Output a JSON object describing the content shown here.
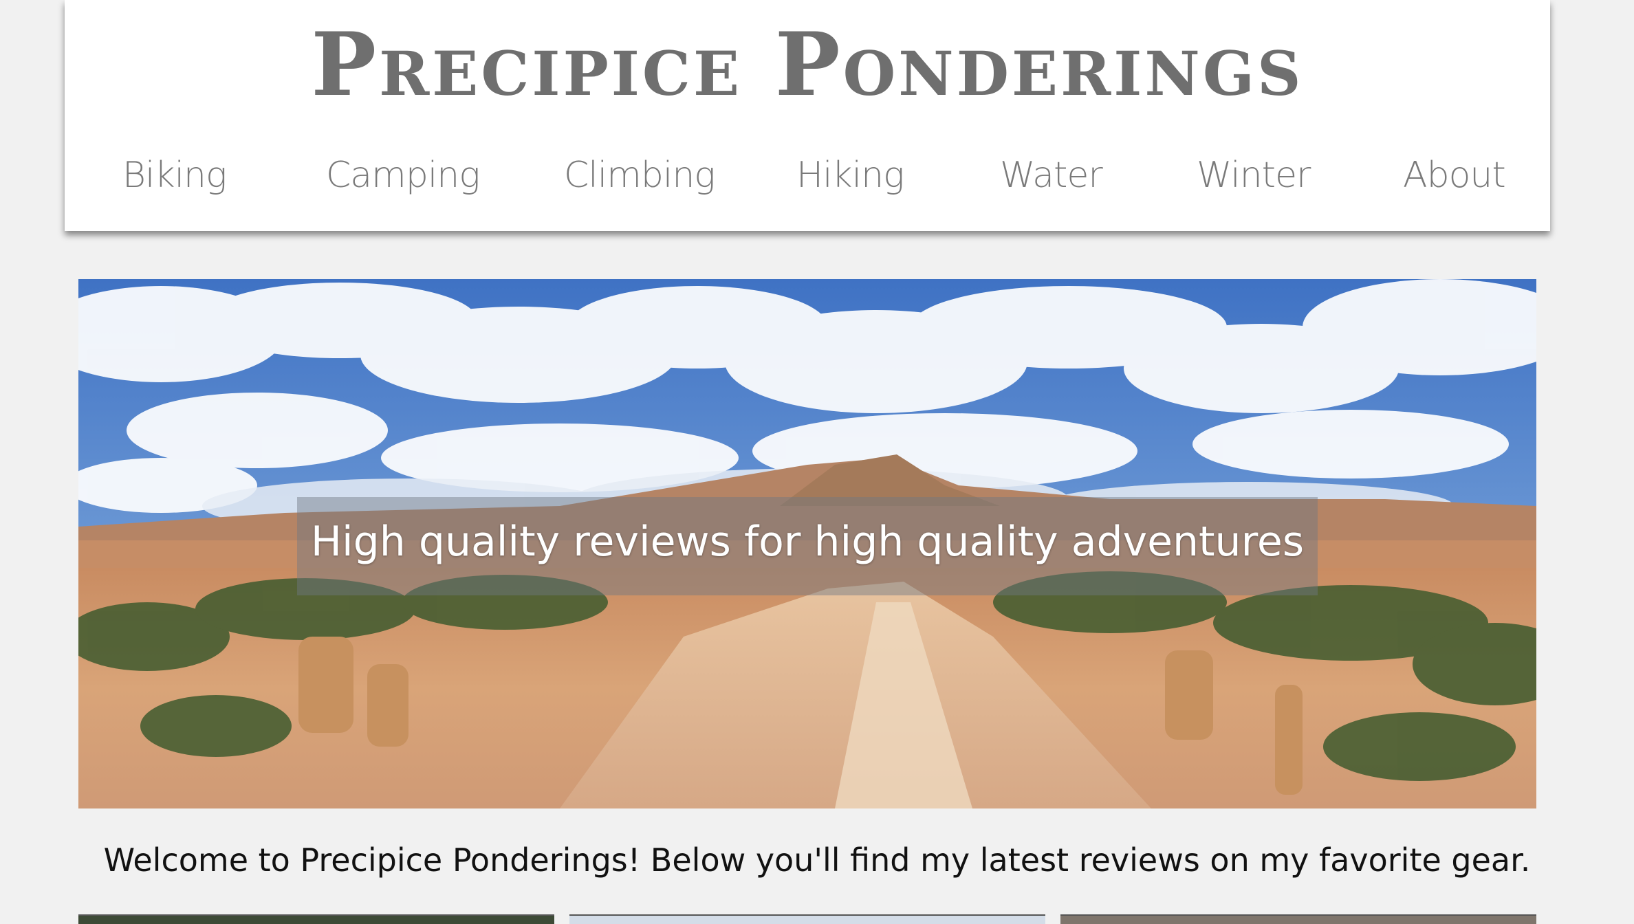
{
  "site": {
    "title": "Precipice Ponderings"
  },
  "nav": {
    "items": [
      {
        "label": "Biking"
      },
      {
        "label": "Camping"
      },
      {
        "label": "Climbing"
      },
      {
        "label": "Hiking"
      },
      {
        "label": "Water"
      },
      {
        "label": "Winter"
      },
      {
        "label": "About"
      }
    ]
  },
  "hero": {
    "tagline": "High quality reviews for high quality adventures"
  },
  "welcome": {
    "text": "Welcome to Precipice Ponderings! Below you'll find my latest reviews on my favorite gear."
  },
  "colors": {
    "page_background": "#f1f1f1",
    "header_background": "#ffffff",
    "title_color": "#6f6f6f",
    "nav_color": "#7a7a7a",
    "text_color": "#111111"
  }
}
